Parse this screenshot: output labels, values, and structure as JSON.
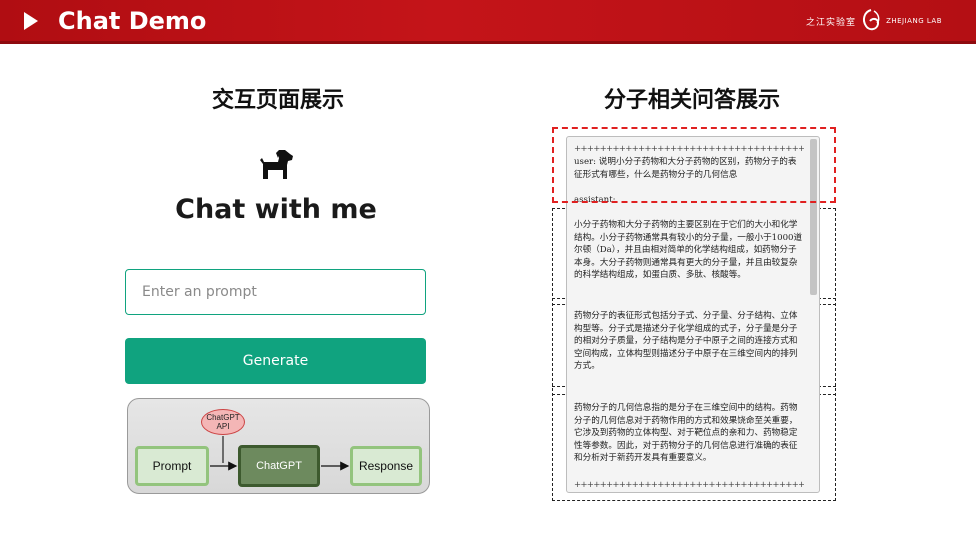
{
  "header": {
    "title": "Chat Demo",
    "logo_cn": "之江实验室",
    "logo_en": "ZHEJIANG LAB"
  },
  "sections": {
    "left_title": "交互页面展示",
    "right_title": "分子相关问答展示"
  },
  "demo": {
    "heading": "Chat with me",
    "input_placeholder": "Enter an prompt",
    "generate_label": "Generate"
  },
  "flow": {
    "api_line1": "ChatGPT",
    "api_line2": "API",
    "prompt": "Prompt",
    "chatgpt": "ChatGPT",
    "response": "Response"
  },
  "conversation": {
    "separator": "++++++++++++++++++++++++++++++++++++++++++++",
    "user": "user: 说明小分子药物和大分子药物的区别，药物分子的表征形式有哪些，什么是药物分子的几何信息",
    "assistant_label": "assistant:",
    "para1": "小分子药物和大分子药物的主要区别在于它们的大小和化学结构。小分子药物通常具有较小的分子量，一般小于1000道尔顿（Da），并且由相对简单的化学结构组成，如药物分子本身。大分子药物则通常具有更大的分子量，并且由较复杂的科学结构组成，如蛋白质、多肽、核酸等。",
    "para2": "药物分子的表征形式包括分子式、分子量、分子结构、立体构型等。分子式是描述分子化学组成的式子，分子量是分子的相对分子质量，分子结构是分子中原子之间的连接方式和空间构成，立体构型则描述分子中原子在三维空间内的排列方式。",
    "para3": "药物分子的几何信息指的是分子在三维空间中的结构。药物分子的几何信息对于药物作用的方式和效果饶命至关重要，它涉及到药物的立体构型、对于靶位点的亲和力、药物稳定性等参数。因此，对于药物分子的几何信息进行准确的表征和分析对于新药开发具有重要意义。"
  },
  "colors": {
    "header_red": "#c41419",
    "accent_green": "#10a37f",
    "highlight_red": "#e02020"
  }
}
